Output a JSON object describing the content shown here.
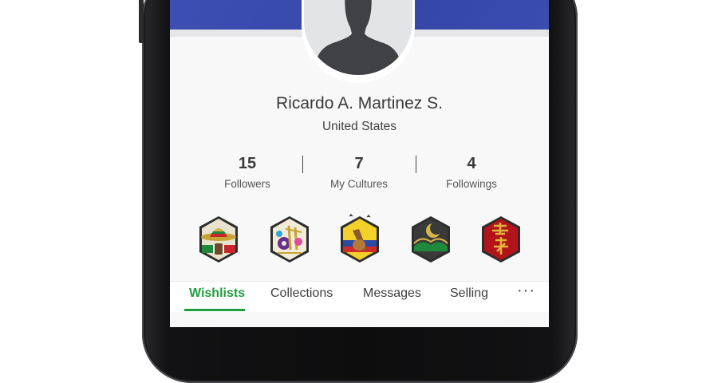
{
  "profile": {
    "name": "Ricardo A. Martinez S.",
    "country": "United States",
    "avatar_icon": "default-user-silhouette-icon"
  },
  "stats": [
    {
      "value": "15",
      "label": "Followers"
    },
    {
      "value": "7",
      "label": "My Cultures"
    },
    {
      "value": "4",
      "label": "Followings"
    }
  ],
  "culture_badges": [
    {
      "icon": "mexico-sombrero-badge-icon"
    },
    {
      "icon": "music-mask-badge-icon"
    },
    {
      "icon": "colombia-music-badge-icon"
    },
    {
      "icon": "crescent-moon-mosque-badge-icon"
    },
    {
      "icon": "chinese-calligraphy-badge-icon"
    }
  ],
  "tabs": {
    "items": [
      {
        "label": "Wishlists",
        "active": true
      },
      {
        "label": "Collections",
        "active": false
      },
      {
        "label": "Messages",
        "active": false
      },
      {
        "label": "Selling",
        "active": false
      }
    ],
    "more_label": "···"
  },
  "colors": {
    "header": "#3d4fb3",
    "accent_green": "#1f9d3e",
    "text": "#3a3a3a"
  }
}
